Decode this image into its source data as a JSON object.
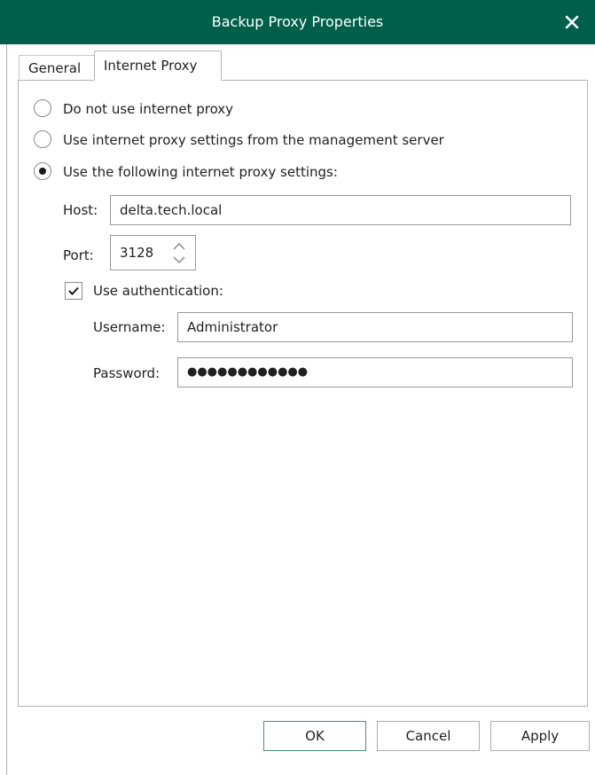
{
  "window": {
    "title": "Backup Proxy Properties"
  },
  "tabs": [
    {
      "label": "General",
      "active": false
    },
    {
      "label": "Internet Proxy",
      "active": true
    }
  ],
  "proxy_options": [
    {
      "label": "Do not use internet proxy",
      "selected": false
    },
    {
      "label": "Use internet proxy settings from the management server",
      "selected": false
    },
    {
      "label": "Use the following internet proxy settings:",
      "selected": true
    }
  ],
  "host": {
    "label": "Host:",
    "value": "delta.tech.local"
  },
  "port": {
    "label": "Port:",
    "value": "3128"
  },
  "authentication": {
    "label": "Use authentication:",
    "checked": true
  },
  "username": {
    "label": "Username:",
    "value": "Administrator"
  },
  "password": {
    "label": "Password:",
    "value": "●●●●●●●●●●●●"
  },
  "buttons": {
    "ok": "OK",
    "cancel": "Cancel",
    "apply": "Apply"
  },
  "colors": {
    "titlebar": "#005f4b",
    "title_text": "#ffffff"
  }
}
